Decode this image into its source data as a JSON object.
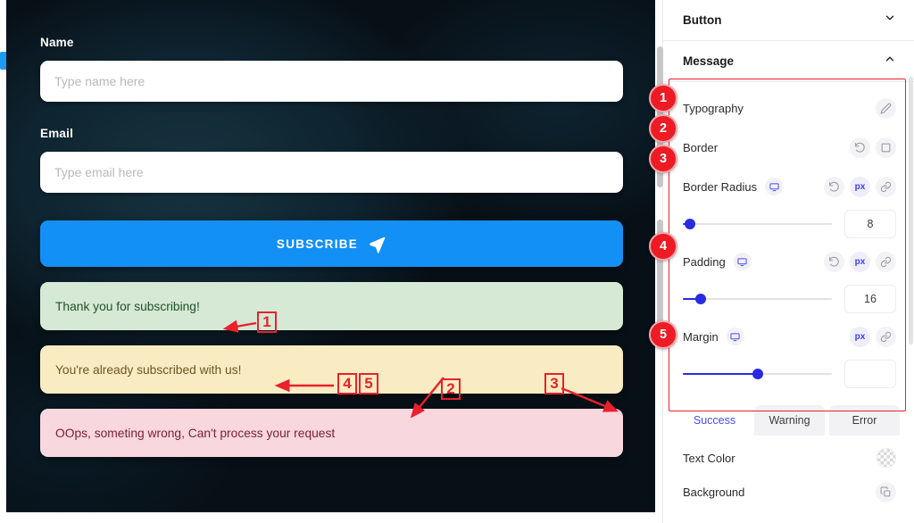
{
  "preview": {
    "name_label": "Name",
    "name_placeholder": "Type name here",
    "name_value": "",
    "email_label": "Email",
    "email_placeholder": "Type email here",
    "email_value": "",
    "subscribe_label": "SUBSCRIBE",
    "subscribe_icon": "paper-plane-icon",
    "messages": [
      {
        "type": "success",
        "text": "Thank you for subscribing!"
      },
      {
        "type": "warning",
        "text": "You're already subscribed with us!"
      },
      {
        "type": "error",
        "text": "OOps, someting wrong, Can't process your request"
      }
    ],
    "colors": {
      "button": "#1390f5",
      "success_bg": "#d6e9d5",
      "success_text": "#20512a",
      "warning_bg": "#faecc2",
      "warning_text": "#6d5620",
      "error_bg": "#f8d7de",
      "error_text": "#7a1f35"
    }
  },
  "panel": {
    "sections": [
      {
        "title": "Button",
        "state": "collapsed",
        "chevron": "chevron-down-icon"
      },
      {
        "title": "Message",
        "state": "expanded",
        "chevron": "chevron-up-icon"
      }
    ],
    "controls": [
      {
        "label": "Typography",
        "device_icon": null,
        "actions": [
          "pencil-icon"
        ]
      },
      {
        "label": "Border",
        "device_icon": null,
        "actions": [
          "reset-icon",
          "border-box-icon"
        ]
      },
      {
        "label": "Border Radius",
        "device_icon": "monitor-icon",
        "actions": [
          "reset-icon",
          "px-unit",
          "link-icon"
        ],
        "unit": "px",
        "slider": {
          "percent": 5,
          "value": "8"
        }
      },
      {
        "label": "Padding",
        "device_icon": "monitor-icon",
        "actions": [
          "reset-icon",
          "px-unit",
          "link-icon"
        ],
        "unit": "px",
        "slider": {
          "percent": 12,
          "value": "16"
        }
      },
      {
        "label": "Margin",
        "device_icon": "monitor-icon",
        "actions": [
          "px-unit",
          "link-icon"
        ],
        "unit": "px",
        "slider": {
          "percent": 50,
          "value": ""
        }
      }
    ],
    "tabs": [
      {
        "label": "Success",
        "active": true
      },
      {
        "label": "Warning",
        "active": false
      },
      {
        "label": "Error",
        "active": false
      }
    ],
    "properties": [
      {
        "label": "Text Color",
        "swatch": "checker-transparent"
      },
      {
        "label": "Background",
        "swatch": "copy-icon"
      }
    ],
    "accent_color": "#4b4bf5",
    "slider_color": "#2a2ae0"
  },
  "annotations": {
    "highlight_color": "#e8212d",
    "circles": [
      {
        "number": "1",
        "target": "Typography"
      },
      {
        "number": "2",
        "target": "Border"
      },
      {
        "number": "3",
        "target": "Border Radius"
      },
      {
        "number": "4",
        "target": "Padding"
      },
      {
        "number": "5",
        "target": "Margin"
      }
    ],
    "callouts": [
      {
        "number": "1",
        "points_to": "success-message"
      },
      {
        "number": "2",
        "points_to": "warning-message-bottom-edge"
      },
      {
        "number": "3",
        "points_to": "warning-message-right-corner"
      },
      {
        "number": "4",
        "points_to": "warning-message-text"
      },
      {
        "number": "5",
        "points_to": "warning-message-text"
      }
    ]
  }
}
